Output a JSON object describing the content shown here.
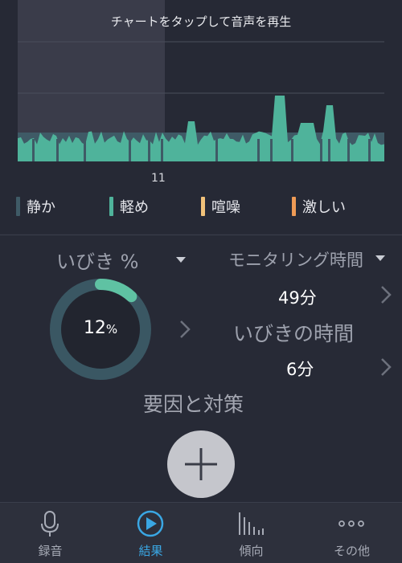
{
  "chart": {
    "hint": "チャートをタップして音声を再生",
    "hour_label": "11",
    "colors": {
      "quiet": "#3f5a66",
      "light": "#4fb39b",
      "loud": "#f1c27a",
      "heavy": "#ee9a55",
      "highlight": "#4a4d5b"
    },
    "legend": [
      {
        "label": "静か",
        "color": "#3f5a66"
      },
      {
        "label": "軽め",
        "color": "#4fb39b"
      },
      {
        "label": "喧噪",
        "color": "#f1c27a"
      },
      {
        "label": "激しい",
        "color": "#ee9a55"
      }
    ]
  },
  "stats": {
    "snore_title": "いびき %",
    "snore_percent": 12,
    "snore_percent_value": "12",
    "snore_percent_unit": "%",
    "monitor_title": "モニタリング時間",
    "monitor_value": "49分",
    "snore_time_title": "いびきの時間",
    "snore_time_value": "6分",
    "ring_colors": {
      "track": "#3a5763",
      "fill": "#5fc2a3",
      "center": "#22252f"
    }
  },
  "remedies": {
    "title": "要因と対策"
  },
  "tabbar": {
    "active_color": "#3aa7e4",
    "items": [
      {
        "label": "録音",
        "icon": "microphone-icon",
        "active": false
      },
      {
        "label": "結果",
        "icon": "play-circle-icon",
        "active": true
      },
      {
        "label": "傾向",
        "icon": "bar-chart-icon",
        "active": false
      },
      {
        "label": "その他",
        "icon": "more-dots-icon",
        "active": false
      }
    ]
  }
}
